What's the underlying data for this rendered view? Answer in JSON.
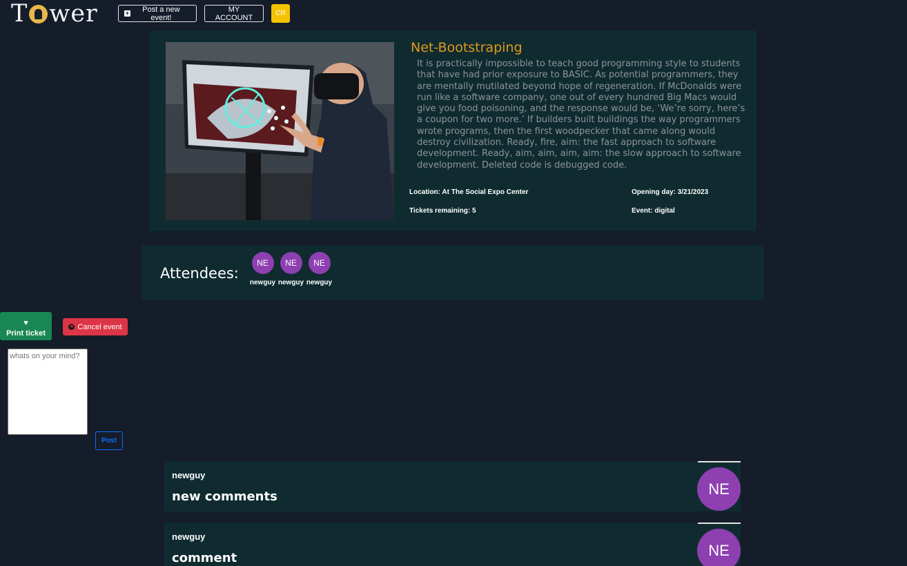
{
  "navbar": {
    "logo_prefix": "T",
    "logo_suffix": "wer",
    "post_event_label": "Post a new event!",
    "account_label": "MY ACCOUNT",
    "account_initials": "CR"
  },
  "event": {
    "title": "Net-Bootstraping",
    "description": "It is practically impossible to teach good programming style to students that have had prior exposure to BASIC. As potential programmers, they are mentally mutilated beyond hope of regeneration. If McDonalds were run like a software company, one out of every hundred Big Macs would give you food poisoning, and the response would be, ‘We’re sorry, here’s a coupon for two more.’ If builders built buildings the way programmers wrote programs, then the first woodpecker that came along would destroy civilization. Ready, fire, aim: the fast approach to software development. Ready, aim, aim, aim, aim: the slow approach to software development. Deleted code is debugged code.",
    "location": "Location: At The Social Expo Center",
    "tickets": "Tickets remaining: 5",
    "opening": "Opening day: 3/21/2023",
    "type": "Event: digital"
  },
  "attendees": {
    "label": "Attendees:",
    "items": [
      {
        "initials": "NE",
        "name": "newguy"
      },
      {
        "initials": "NE",
        "name": "newguy"
      },
      {
        "initials": "NE",
        "name": "newguy"
      }
    ]
  },
  "actions": {
    "print_label": "Print ticket",
    "cancel_label": "Cancel event",
    "comment_placeholder": "whats on your mind?",
    "post_label": "Post"
  },
  "comments": [
    {
      "author": "newguy",
      "body": "new comments",
      "initials": "NE"
    },
    {
      "author": "newguy",
      "body": "comment",
      "initials": "NE"
    }
  ],
  "colors": {
    "background": "#151c2a",
    "card": "#0f2b30",
    "title": "#e09a1e",
    "avatar": "#8e3fb0",
    "success": "#198754",
    "danger": "#dc3545",
    "primary": "#0d6efd",
    "warning": "#f3c300"
  }
}
